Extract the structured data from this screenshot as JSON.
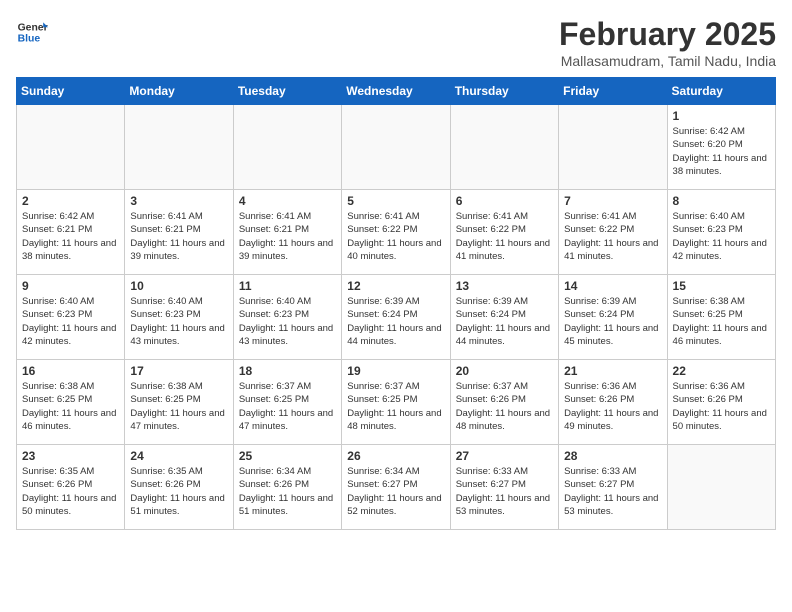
{
  "header": {
    "logo_line1": "General",
    "logo_line2": "Blue",
    "month_year": "February 2025",
    "location": "Mallasamudram, Tamil Nadu, India"
  },
  "weekdays": [
    "Sunday",
    "Monday",
    "Tuesday",
    "Wednesday",
    "Thursday",
    "Friday",
    "Saturday"
  ],
  "weeks": [
    [
      {
        "day": "",
        "info": ""
      },
      {
        "day": "",
        "info": ""
      },
      {
        "day": "",
        "info": ""
      },
      {
        "day": "",
        "info": ""
      },
      {
        "day": "",
        "info": ""
      },
      {
        "day": "",
        "info": ""
      },
      {
        "day": "1",
        "info": "Sunrise: 6:42 AM\nSunset: 6:20 PM\nDaylight: 11 hours and 38 minutes."
      }
    ],
    [
      {
        "day": "2",
        "info": "Sunrise: 6:42 AM\nSunset: 6:21 PM\nDaylight: 11 hours and 38 minutes."
      },
      {
        "day": "3",
        "info": "Sunrise: 6:41 AM\nSunset: 6:21 PM\nDaylight: 11 hours and 39 minutes."
      },
      {
        "day": "4",
        "info": "Sunrise: 6:41 AM\nSunset: 6:21 PM\nDaylight: 11 hours and 39 minutes."
      },
      {
        "day": "5",
        "info": "Sunrise: 6:41 AM\nSunset: 6:22 PM\nDaylight: 11 hours and 40 minutes."
      },
      {
        "day": "6",
        "info": "Sunrise: 6:41 AM\nSunset: 6:22 PM\nDaylight: 11 hours and 41 minutes."
      },
      {
        "day": "7",
        "info": "Sunrise: 6:41 AM\nSunset: 6:22 PM\nDaylight: 11 hours and 41 minutes."
      },
      {
        "day": "8",
        "info": "Sunrise: 6:40 AM\nSunset: 6:23 PM\nDaylight: 11 hours and 42 minutes."
      }
    ],
    [
      {
        "day": "9",
        "info": "Sunrise: 6:40 AM\nSunset: 6:23 PM\nDaylight: 11 hours and 42 minutes."
      },
      {
        "day": "10",
        "info": "Sunrise: 6:40 AM\nSunset: 6:23 PM\nDaylight: 11 hours and 43 minutes."
      },
      {
        "day": "11",
        "info": "Sunrise: 6:40 AM\nSunset: 6:23 PM\nDaylight: 11 hours and 43 minutes."
      },
      {
        "day": "12",
        "info": "Sunrise: 6:39 AM\nSunset: 6:24 PM\nDaylight: 11 hours and 44 minutes."
      },
      {
        "day": "13",
        "info": "Sunrise: 6:39 AM\nSunset: 6:24 PM\nDaylight: 11 hours and 44 minutes."
      },
      {
        "day": "14",
        "info": "Sunrise: 6:39 AM\nSunset: 6:24 PM\nDaylight: 11 hours and 45 minutes."
      },
      {
        "day": "15",
        "info": "Sunrise: 6:38 AM\nSunset: 6:25 PM\nDaylight: 11 hours and 46 minutes."
      }
    ],
    [
      {
        "day": "16",
        "info": "Sunrise: 6:38 AM\nSunset: 6:25 PM\nDaylight: 11 hours and 46 minutes."
      },
      {
        "day": "17",
        "info": "Sunrise: 6:38 AM\nSunset: 6:25 PM\nDaylight: 11 hours and 47 minutes."
      },
      {
        "day": "18",
        "info": "Sunrise: 6:37 AM\nSunset: 6:25 PM\nDaylight: 11 hours and 47 minutes."
      },
      {
        "day": "19",
        "info": "Sunrise: 6:37 AM\nSunset: 6:25 PM\nDaylight: 11 hours and 48 minutes."
      },
      {
        "day": "20",
        "info": "Sunrise: 6:37 AM\nSunset: 6:26 PM\nDaylight: 11 hours and 48 minutes."
      },
      {
        "day": "21",
        "info": "Sunrise: 6:36 AM\nSunset: 6:26 PM\nDaylight: 11 hours and 49 minutes."
      },
      {
        "day": "22",
        "info": "Sunrise: 6:36 AM\nSunset: 6:26 PM\nDaylight: 11 hours and 50 minutes."
      }
    ],
    [
      {
        "day": "23",
        "info": "Sunrise: 6:35 AM\nSunset: 6:26 PM\nDaylight: 11 hours and 50 minutes."
      },
      {
        "day": "24",
        "info": "Sunrise: 6:35 AM\nSunset: 6:26 PM\nDaylight: 11 hours and 51 minutes."
      },
      {
        "day": "25",
        "info": "Sunrise: 6:34 AM\nSunset: 6:26 PM\nDaylight: 11 hours and 51 minutes."
      },
      {
        "day": "26",
        "info": "Sunrise: 6:34 AM\nSunset: 6:27 PM\nDaylight: 11 hours and 52 minutes."
      },
      {
        "day": "27",
        "info": "Sunrise: 6:33 AM\nSunset: 6:27 PM\nDaylight: 11 hours and 53 minutes."
      },
      {
        "day": "28",
        "info": "Sunrise: 6:33 AM\nSunset: 6:27 PM\nDaylight: 11 hours and 53 minutes."
      },
      {
        "day": "",
        "info": ""
      }
    ]
  ]
}
